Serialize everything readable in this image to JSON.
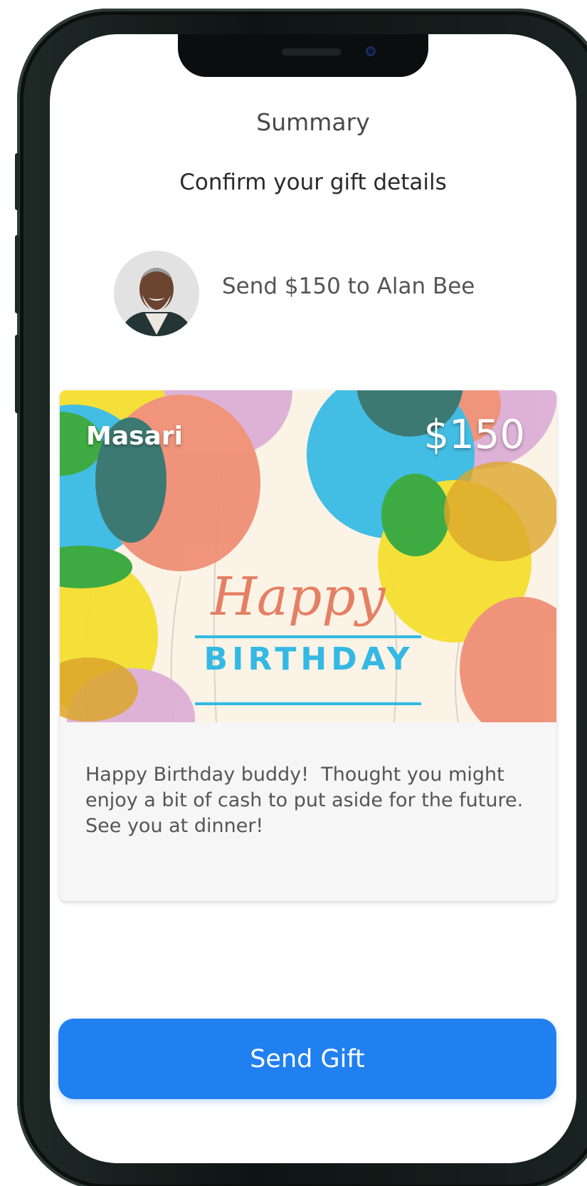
{
  "header": {
    "title": "Summary",
    "subtitle": "Confirm your gift details"
  },
  "recipient": {
    "text": "Send $150 to Alan Bee",
    "avatar_icon": "person-avatar"
  },
  "gift_card": {
    "brand": "Masari",
    "amount": "$150",
    "art_headline_script": "Happy",
    "art_headline_caps": "BIRTHDAY",
    "message": "Happy Birthday buddy!  Thought you might enjoy a bit of cash to put aside for the future.  See you at dinner!"
  },
  "actions": {
    "send_label": "Send Gift"
  },
  "colors": {
    "accent": "#2180f0",
    "card_background": "#fbf3e6",
    "balloon_blue": "#33b9e3",
    "balloon_coral": "#ef8c72",
    "balloon_yellow": "#f4df2a",
    "balloon_pink": "#dcadd6",
    "balloon_green": "#2fa535"
  }
}
